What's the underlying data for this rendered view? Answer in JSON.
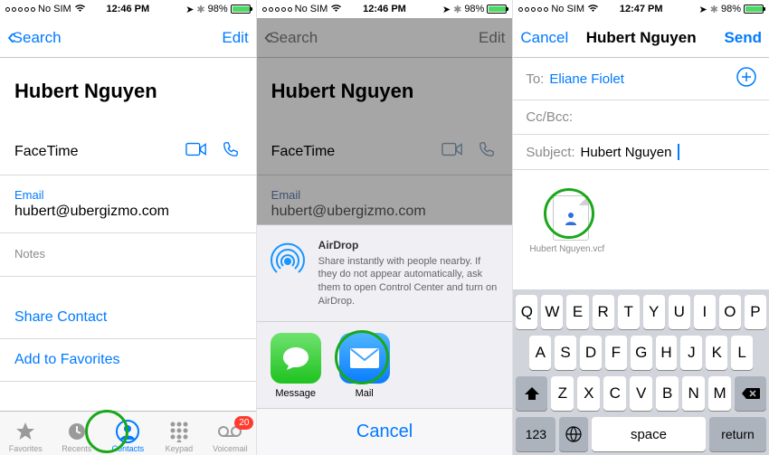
{
  "panel1": {
    "status": {
      "carrier": "No SIM",
      "time": "12:46 PM",
      "batt_pct": "98%"
    },
    "nav": {
      "back": "Search",
      "edit": "Edit"
    },
    "name": "Hubert Nguyen",
    "facetime_label": "FaceTime",
    "email_label": "Email",
    "email_value": "hubert@ubergizmo.com",
    "notes_label": "Notes",
    "share_contact": "Share Contact",
    "add_fav": "Add to Favorites",
    "tabs": {
      "fav": "Favorites",
      "rec": "Recents",
      "con": "Contacts",
      "key": "Keypad",
      "vm": "Voicemail",
      "vm_badge": "20"
    }
  },
  "panel2": {
    "status": {
      "carrier": "No SIM",
      "time": "12:46 PM",
      "batt_pct": "98%"
    },
    "nav": {
      "back": "Search",
      "edit": "Edit"
    },
    "name": "Hubert Nguyen",
    "facetime_label": "FaceTime",
    "email_label": "Email",
    "email_value": "hubert@ubergizmo.com",
    "airdrop_title": "AirDrop",
    "airdrop_desc": "Share instantly with people nearby. If they do not appear automatically, ask them to open Control Center and turn on AirDrop.",
    "share": {
      "message": "Message",
      "mail": "Mail"
    },
    "cancel": "Cancel"
  },
  "panel3": {
    "status": {
      "carrier": "No SIM",
      "time": "12:47 PM",
      "batt_pct": "98%"
    },
    "nav": {
      "cancel": "Cancel",
      "title": "Hubert Nguyen",
      "send": "Send"
    },
    "to_label": "To:",
    "to_value": "Eliane Fiolet",
    "cc_label": "Cc/Bcc:",
    "subj_label": "Subject:",
    "subj_value": "Hubert Nguyen",
    "attach_name": "Hubert Nguyen.vcf",
    "kbd": {
      "row1": [
        "Q",
        "W",
        "E",
        "R",
        "T",
        "Y",
        "U",
        "I",
        "O",
        "P"
      ],
      "row2": [
        "A",
        "S",
        "D",
        "F",
        "G",
        "H",
        "J",
        "K",
        "L"
      ],
      "row3": [
        "Z",
        "X",
        "C",
        "V",
        "B",
        "N",
        "M"
      ],
      "num": "123",
      "space": "space",
      "ret": "return"
    }
  }
}
